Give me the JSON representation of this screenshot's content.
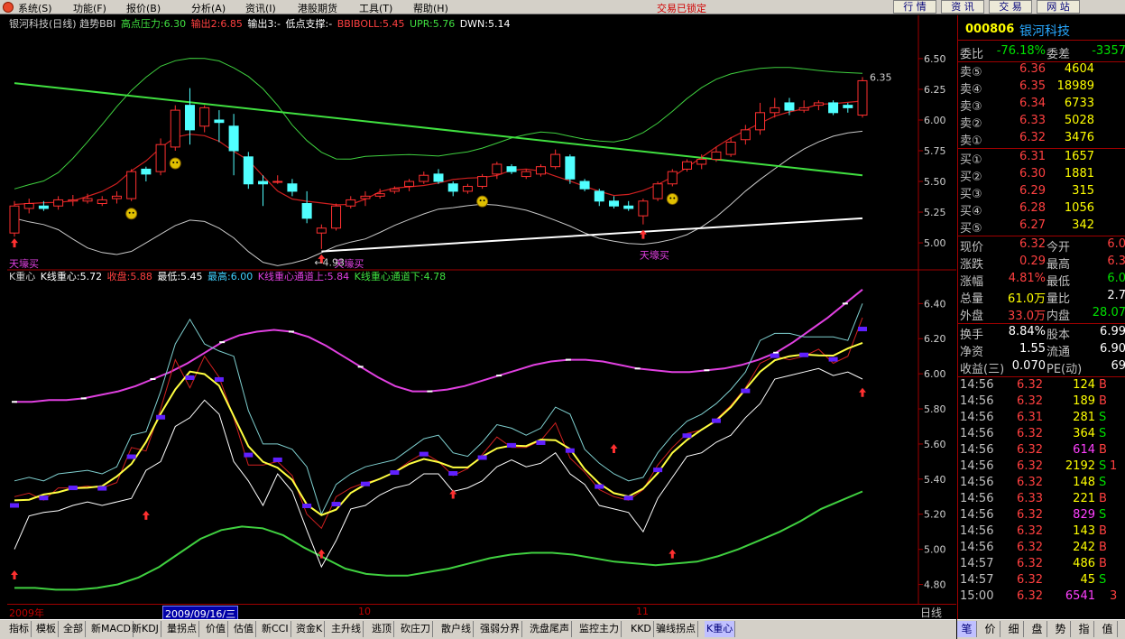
{
  "menu": [
    "系统(S)",
    "功能(F)",
    "报价(B)",
    "分析(A)",
    "资讯(I)",
    "港股期货",
    "工具(T)",
    "帮助(H)"
  ],
  "lock_status": "交易已锁定",
  "top_buttons": [
    "行 情",
    "资 讯",
    "交 易",
    "网 站"
  ],
  "colors": {
    "up": "#ff3030",
    "down": "#50ffff",
    "bbi": "#d02020",
    "upper": "#3fd03f",
    "lower": "#c8c8c8",
    "trend_green": "#40e040",
    "trend_white": "#ffffff",
    "magenta": "#e040e0",
    "green_band": "#40d040"
  },
  "upper_legend": [
    {
      "text": "银河科技(日线) 趋势BBI",
      "color": "#d0d0d0"
    },
    {
      "text": "高点压力:6.30",
      "color": "#40e040"
    },
    {
      "text": "输出2:6.85",
      "color": "#ff4040"
    },
    {
      "text": "输出3:-",
      "color": "#ffffff"
    },
    {
      "text": "低点支撑:-",
      "color": "#ffffff"
    },
    {
      "text": "BBIBOLL:5.45",
      "color": "#ff4040"
    },
    {
      "text": "UPR:5.76",
      "color": "#40e040"
    },
    {
      "text": "DWN:5.14",
      "color": "#ffffff"
    }
  ],
  "lower_legend": [
    {
      "text": "K重心",
      "color": "#d0d0d0"
    },
    {
      "text": "K线重心:5.72",
      "color": "#ffffff"
    },
    {
      "text": "收盘:5.88",
      "color": "#ff4040"
    },
    {
      "text": "最低:5.45",
      "color": "#ffffff"
    },
    {
      "text": "最高:6.00",
      "color": "#40d0ff"
    },
    {
      "text": "K线重心通道上:5.84",
      "color": "#e040e0"
    },
    {
      "text": "K线重心通道下:4.78",
      "color": "#40e040"
    }
  ],
  "upper_axis": [
    "6.50",
    "6.25",
    "6.00",
    "5.75",
    "5.50",
    "5.25",
    "5.00"
  ],
  "lower_axis": [
    "6.40",
    "6.20",
    "6.00",
    "5.80",
    "5.60",
    "5.40",
    "5.20",
    "5.00",
    "4.80"
  ],
  "annotations": {
    "buy1": "天壕买",
    "buy2": "天壕买",
    "buy3": "天壕买",
    "low_mark": "4.93",
    "high_mark": "6.35"
  },
  "x_labels": {
    "year": "2009年",
    "m10": "10",
    "m11": "11"
  },
  "cursor_date": "2009/09/16/三",
  "period": "日线",
  "tabs": [
    "指标",
    "模板",
    "全部",
    "新MACD",
    "新KDJ",
    "量拐点",
    "价值",
    "估值",
    "新CCI",
    "资金K",
    "主升线",
    "逃顶",
    "砍庄刀",
    "散户线",
    "强弱分界",
    "洗盘尾声",
    "监控主力",
    "KKD",
    "骗线拐点",
    "K重心"
  ],
  "active_tab": "K重心",
  "stock": {
    "code": "000806",
    "name": "银河科技"
  },
  "wei": {
    "bi_label": "委比",
    "bi": "-76.18%",
    "cha_label": "委差",
    "cha": "-3357"
  },
  "asks": [
    {
      "label": "卖⑤",
      "price": "6.36",
      "vol": "4604"
    },
    {
      "label": "卖④",
      "price": "6.35",
      "vol": "18989"
    },
    {
      "label": "卖③",
      "price": "6.34",
      "vol": "6733"
    },
    {
      "label": "卖②",
      "price": "6.33",
      "vol": "5028"
    },
    {
      "label": "卖①",
      "price": "6.32",
      "vol": "3476"
    }
  ],
  "bids": [
    {
      "label": "买①",
      "price": "6.31",
      "vol": "1657"
    },
    {
      "label": "买②",
      "price": "6.30",
      "vol": "1881"
    },
    {
      "label": "买③",
      "price": "6.29",
      "vol": "315"
    },
    {
      "label": "买④",
      "price": "6.28",
      "vol": "1056"
    },
    {
      "label": "买⑤",
      "price": "6.27",
      "vol": "342"
    }
  ],
  "stats": [
    {
      "l1": "现价",
      "v1": "6.32",
      "l2": "今开",
      "v2": "6.0"
    },
    {
      "l1": "涨跌",
      "v1": "0.29",
      "l2": "最高",
      "v2": "6.3"
    },
    {
      "l1": "涨幅",
      "v1": "4.81%",
      "l2": "最低",
      "v2": "6.0"
    },
    {
      "l1": "总量",
      "v1": "61.0万",
      "l2": "量比",
      "v2": "2.7"
    },
    {
      "l1": "外盘",
      "v1": "33.0万",
      "l2": "内盘",
      "v2": "28.07"
    },
    {
      "l1": "换手",
      "v1": "8.84%",
      "l2": "股本",
      "v2": "6.99"
    },
    {
      "l1": "净资",
      "v1": "1.55",
      "l2": "流通",
      "v2": "6.90"
    },
    {
      "l1": "收益(三)",
      "v1": "0.070",
      "l2": "PE(动)",
      "v2": "69"
    }
  ],
  "ticks": [
    {
      "time": "14:56",
      "price": "6.32",
      "vol": "124",
      "dir": "B"
    },
    {
      "time": "14:56",
      "price": "6.32",
      "vol": "189",
      "dir": "B"
    },
    {
      "time": "14:56",
      "price": "6.31",
      "vol": "281",
      "dir": "S"
    },
    {
      "time": "14:56",
      "price": "6.32",
      "vol": "364",
      "dir": "S"
    },
    {
      "time": "14:56",
      "price": "6.32",
      "vol": "614",
      "dir": "B",
      "hl": true
    },
    {
      "time": "14:56",
      "price": "6.32",
      "vol": "2192",
      "dir": "S",
      "extra": "1"
    },
    {
      "time": "14:56",
      "price": "6.32",
      "vol": "148",
      "dir": "S"
    },
    {
      "time": "14:56",
      "price": "6.33",
      "vol": "221",
      "dir": "B"
    },
    {
      "time": "14:56",
      "price": "6.32",
      "vol": "829",
      "dir": "S",
      "hl": true
    },
    {
      "time": "14:56",
      "price": "6.32",
      "vol": "143",
      "dir": "B"
    },
    {
      "time": "14:56",
      "price": "6.32",
      "vol": "242",
      "dir": "B"
    },
    {
      "time": "14:57",
      "price": "6.32",
      "vol": "486",
      "dir": "B"
    },
    {
      "time": "14:57",
      "price": "6.32",
      "vol": "45",
      "dir": "S"
    },
    {
      "time": "15:00",
      "price": "6.32",
      "vol": "6541",
      "dir": "",
      "hl": true,
      "extra": "3"
    }
  ],
  "side_tabs": [
    "笔",
    "价",
    "细",
    "盘",
    "势",
    "指",
    "值"
  ],
  "chart_data": [
    {
      "type": "candlestick",
      "name": "upper",
      "ylim": [
        4.78,
        6.72
      ],
      "candles": [
        [
          5.08,
          5.3,
          5.05,
          5.34
        ],
        [
          5.28,
          5.32,
          5.24,
          5.36
        ],
        [
          5.3,
          5.28,
          5.26,
          5.34
        ],
        [
          5.3,
          5.35,
          5.27,
          5.38
        ],
        [
          5.34,
          5.35,
          5.3,
          5.39
        ],
        [
          5.34,
          5.36,
          5.32,
          5.4
        ],
        [
          5.32,
          5.35,
          5.3,
          5.38
        ],
        [
          5.36,
          5.38,
          5.32,
          5.42
        ],
        [
          5.36,
          5.58,
          5.34,
          5.6
        ],
        [
          5.6,
          5.56,
          5.5,
          5.62
        ],
        [
          5.58,
          5.8,
          5.55,
          5.85
        ],
        [
          5.78,
          6.08,
          5.75,
          6.12
        ],
        [
          6.12,
          5.92,
          5.8,
          6.26
        ],
        [
          5.95,
          6.1,
          5.9,
          6.12
        ],
        [
          6.0,
          5.98,
          5.82,
          6.08
        ],
        [
          5.95,
          5.75,
          5.55,
          6.05
        ],
        [
          5.7,
          5.48,
          5.44,
          5.74
        ],
        [
          5.5,
          5.48,
          5.3,
          5.55
        ],
        [
          5.5,
          5.5,
          5.48,
          5.55
        ],
        [
          5.48,
          5.42,
          5.38,
          5.52
        ],
        [
          5.32,
          5.2,
          5.16,
          5.42
        ],
        [
          5.08,
          5.12,
          4.95,
          5.15
        ],
        [
          5.12,
          5.3,
          5.1,
          5.32
        ],
        [
          5.3,
          5.35,
          5.28,
          5.38
        ],
        [
          5.36,
          5.38,
          5.3,
          5.42
        ],
        [
          5.38,
          5.4,
          5.36,
          5.44
        ],
        [
          5.42,
          5.44,
          5.4,
          5.46
        ],
        [
          5.46,
          5.5,
          5.42,
          5.52
        ],
        [
          5.5,
          5.55,
          5.48,
          5.58
        ],
        [
          5.56,
          5.5,
          5.48,
          5.6
        ],
        [
          5.48,
          5.42,
          5.38,
          5.5
        ],
        [
          5.42,
          5.46,
          5.4,
          5.48
        ],
        [
          5.46,
          5.54,
          5.44,
          5.56
        ],
        [
          5.56,
          5.64,
          5.52,
          5.66
        ],
        [
          5.62,
          5.58,
          5.56,
          5.64
        ],
        [
          5.54,
          5.58,
          5.52,
          5.6
        ],
        [
          5.56,
          5.62,
          5.54,
          5.64
        ],
        [
          5.62,
          5.72,
          5.6,
          5.76
        ],
        [
          5.7,
          5.52,
          5.48,
          5.72
        ],
        [
          5.5,
          5.44,
          5.42,
          5.52
        ],
        [
          5.42,
          5.34,
          5.3,
          5.44
        ],
        [
          5.34,
          5.3,
          5.28,
          5.38
        ],
        [
          5.3,
          5.28,
          5.26,
          5.34
        ],
        [
          5.22,
          5.34,
          5.15,
          5.36
        ],
        [
          5.36,
          5.48,
          5.34,
          5.5
        ],
        [
          5.48,
          5.58,
          5.46,
          5.6
        ],
        [
          5.6,
          5.66,
          5.58,
          5.68
        ],
        [
          5.64,
          5.68,
          5.6,
          5.72
        ],
        [
          5.68,
          5.74,
          5.66,
          5.78
        ],
        [
          5.72,
          5.82,
          5.7,
          5.86
        ],
        [
          5.84,
          5.92,
          5.8,
          5.96
        ],
        [
          5.92,
          6.06,
          5.88,
          6.14
        ],
        [
          6.06,
          6.1,
          6.02,
          6.18
        ],
        [
          6.14,
          6.08,
          6.04,
          6.18
        ],
        [
          6.08,
          6.1,
          6.06,
          6.16
        ],
        [
          6.12,
          6.14,
          6.08,
          6.16
        ],
        [
          6.14,
          6.06,
          6.04,
          6.16
        ],
        [
          6.12,
          6.1,
          6.06,
          6.14
        ],
        [
          6.04,
          6.32,
          6.02,
          6.35
        ]
      ]
    },
    {
      "type": "line",
      "name": "lower",
      "ylim": [
        4.7,
        6.52
      ],
      "x": [
        0,
        58
      ],
      "series": [
        {
          "name": "K线重心通道上",
          "values": [
            5.84,
            5.84,
            5.85,
            5.85,
            5.86,
            5.88,
            5.9,
            5.93,
            5.97,
            6.01,
            6.06,
            6.12,
            6.18,
            6.22,
            6.24,
            6.25,
            6.24,
            6.21,
            6.16,
            6.1,
            6.04,
            5.98,
            5.93,
            5.9,
            5.9,
            5.91,
            5.93,
            5.96,
            5.99,
            6.02,
            6.05,
            6.07,
            6.08,
            6.08,
            6.07,
            6.05,
            6.03,
            6.02,
            6.01,
            6.01,
            6.02,
            6.03,
            6.05,
            6.08,
            6.12,
            6.18,
            6.25,
            6.32,
            6.4,
            6.48
          ]
        },
        {
          "name": "K线重心通道下",
          "values": [
            4.78,
            4.78,
            4.77,
            4.77,
            4.78,
            4.8,
            4.84,
            4.9,
            4.98,
            5.06,
            5.11,
            5.13,
            5.12,
            5.08,
            5.01,
            4.95,
            4.89,
            4.86,
            4.85,
            4.85,
            4.87,
            4.89,
            4.92,
            4.95,
            4.97,
            4.98,
            4.98,
            4.97,
            4.95,
            4.93,
            4.92,
            4.91,
            4.92,
            4.93,
            4.96,
            5.0,
            5.05,
            5.1,
            5.16,
            5.23,
            5.28,
            5.33
          ]
        }
      ]
    }
  ]
}
